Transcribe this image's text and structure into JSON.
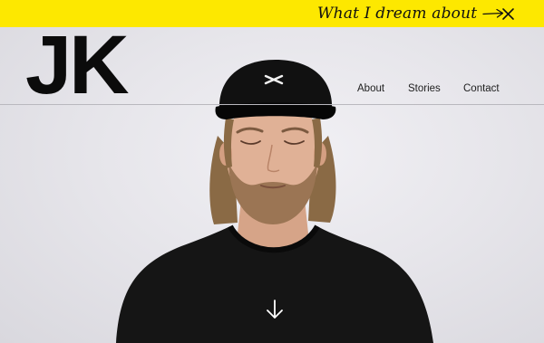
{
  "banner": {
    "text": "What I dream about",
    "arrow_icon": "long-arrow-right-icon",
    "close_icon": "close-icon",
    "background": "#fde800"
  },
  "logo": {
    "text": "JK"
  },
  "nav": {
    "items": [
      {
        "label": "About"
      },
      {
        "label": "Stories"
      },
      {
        "label": "Contact"
      }
    ]
  },
  "hero": {
    "scroll_icon": "arrow-down-icon",
    "image": "portrait of man with closed eyes wearing black cap and black t-shirt"
  }
}
